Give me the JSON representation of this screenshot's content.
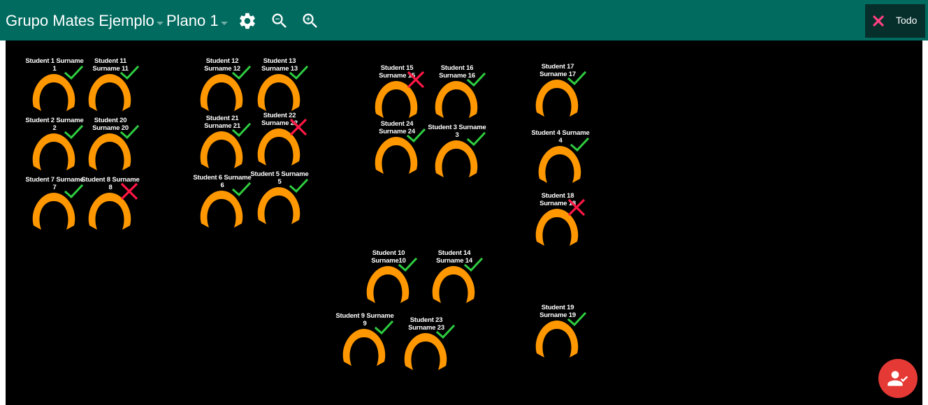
{
  "toolbar": {
    "group_select": "Grupo Mates Ejemplo",
    "plan_select": "Plano 1",
    "settings_icon": "gear-icon",
    "zoom_out_icon": "zoom-out-icon",
    "zoom_in_icon": "zoom-in-icon",
    "filter_button_label": "Todo",
    "filter_button_icon": "close-icon"
  },
  "colors": {
    "toolbar": "#016b5f",
    "filter_button": "#062f2b",
    "canvas": "#000000",
    "chair": "#ff9800",
    "present": "#2ecc40",
    "absent": "#ff1744",
    "fab": "#e53935"
  },
  "seats": [
    {
      "line1": "Student 1 Surname",
      "line2": "1",
      "status": "present"
    },
    {
      "line1": "Student 11",
      "line2": "Surname 11",
      "status": "present"
    },
    {
      "line1": "Student 2 Surname",
      "line2": "2",
      "status": "present"
    },
    {
      "line1": "Student 20",
      "line2": "Surname 20",
      "status": "present"
    },
    {
      "line1": "Student 7 Surname",
      "line2": "7",
      "status": "present"
    },
    {
      "line1": "Student 8 Surname",
      "line2": "8",
      "status": "absent"
    },
    {
      "line1": "Student 12",
      "line2": "Surname 12",
      "status": "present"
    },
    {
      "line1": "Student 13",
      "line2": "Surname 13",
      "status": "present"
    },
    {
      "line1": "Student 21",
      "line2": "Surname 21",
      "status": "present"
    },
    {
      "line1": "Student 22",
      "line2": "Surname 22",
      "status": "absent"
    },
    {
      "line1": "Student 6 Surname",
      "line2": "6",
      "status": "present"
    },
    {
      "line1": "Student 5 Surname",
      "line2": "5",
      "status": "present"
    },
    {
      "line1": "Student 15",
      "line2": "Surname 15",
      "status": "absent"
    },
    {
      "line1": "Student 16",
      "line2": "Surname 16",
      "status": "present"
    },
    {
      "line1": "Student 24",
      "line2": "Surname 24",
      "status": "present"
    },
    {
      "line1": "Student 3 Surname",
      "line2": "3",
      "status": "present"
    },
    {
      "line1": "Student 17",
      "line2": "Surname 17",
      "status": "present"
    },
    {
      "line1": "Student 4 Surname",
      "line2": "4",
      "status": "present"
    },
    {
      "line1": "Student 18",
      "line2": "Surname 18",
      "status": "absent"
    },
    {
      "line1": "Student 10",
      "line2": "Surname10",
      "status": "present"
    },
    {
      "line1": "Student 14",
      "line2": "Surname 14",
      "status": "present"
    },
    {
      "line1": "Student 9 Surname",
      "line2": "9",
      "status": "present"
    },
    {
      "line1": "Student 23",
      "line2": "Surname 23",
      "status": "present"
    },
    {
      "line1": "Student 19",
      "line2": "Surname 19",
      "status": "present"
    }
  ],
  "fab": {
    "icon": "take-attendance-icon"
  }
}
